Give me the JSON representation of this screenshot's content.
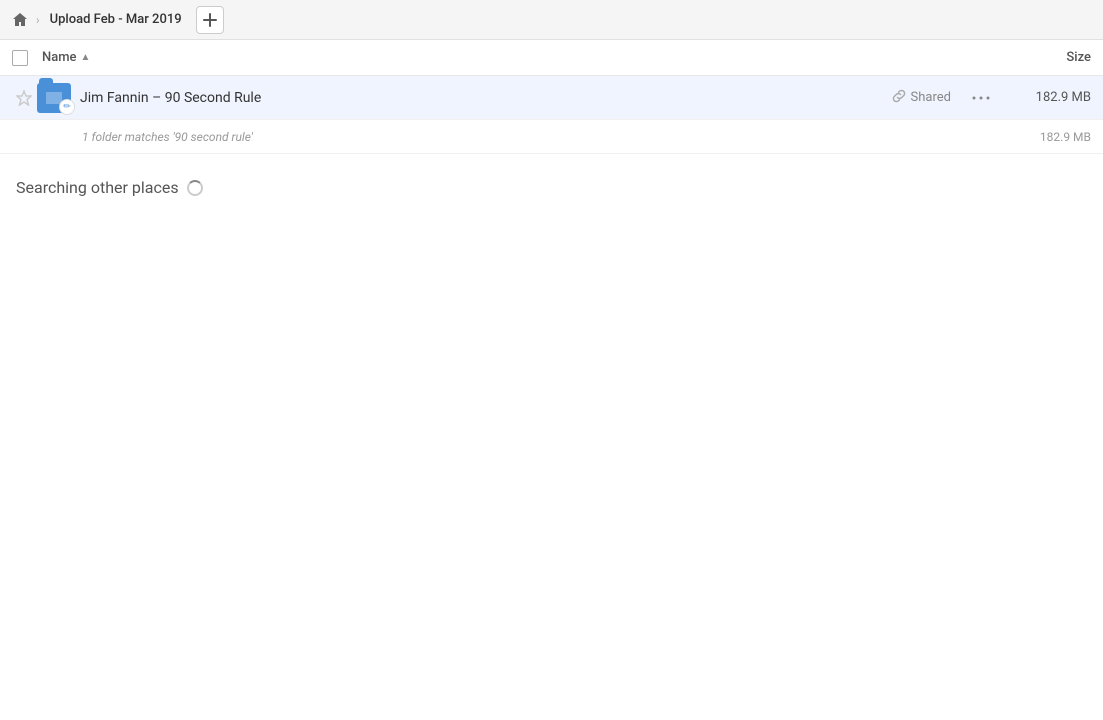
{
  "topbar": {
    "breadcrumb_title": "Upload Feb - Mar 2019",
    "add_tab_label": "+"
  },
  "columns": {
    "name_label": "Name",
    "size_label": "Size"
  },
  "file_row": {
    "name": "Jim Fannin – 90 Second Rule",
    "shared_label": "Shared",
    "size": "182.9 MB",
    "more_icon": "•••"
  },
  "match_row": {
    "text": "1 folder matches '90 second rule'",
    "size": "182.9 MB"
  },
  "searching_section": {
    "label": "Searching other places"
  },
  "icons": {
    "home": "⌂",
    "arrow_right": "›",
    "sort_up": "▲",
    "star_empty": "☆",
    "link": "🔗"
  }
}
